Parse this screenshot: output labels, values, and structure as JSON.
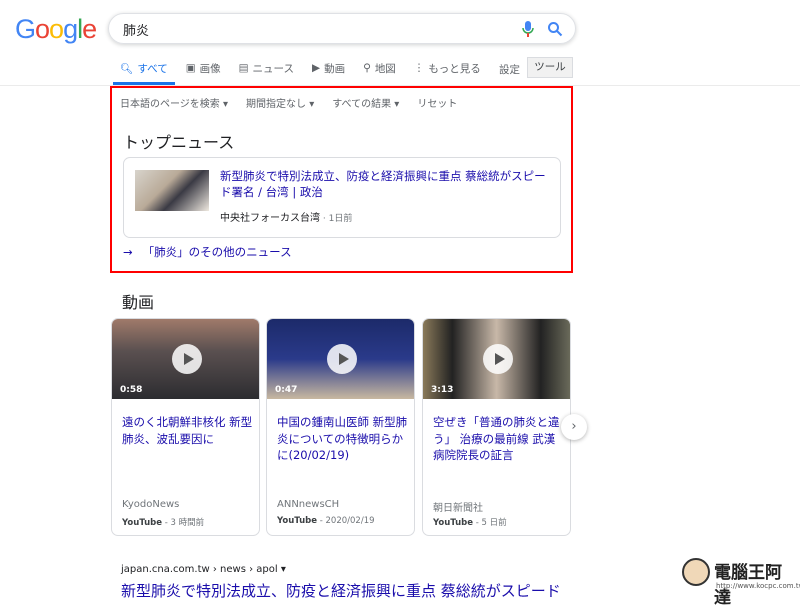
{
  "logo": "Google",
  "search": {
    "query": "肺炎"
  },
  "tabs": [
    {
      "label": "すべて",
      "icon": "search-icon"
    },
    {
      "label": "画像",
      "icon": "image-icon"
    },
    {
      "label": "ニュース",
      "icon": "news-icon"
    },
    {
      "label": "動画",
      "icon": "video-icon"
    },
    {
      "label": "地図",
      "icon": "map-pin-icon"
    },
    {
      "label": "もっと見る",
      "icon": "more-vert-icon"
    }
  ],
  "settings_label": "設定",
  "tools_label": "ツール",
  "filters": [
    "日本語のページを検索",
    "期間指定なし",
    "すべての結果",
    "リセット"
  ],
  "top_news": {
    "heading": "トップニュース",
    "title": "新型肺炎で特別法成立、防疫と経済振興に重点 蔡総統がスピード署名 / 台湾 | 政治",
    "source": "中央社フォーカス台湾",
    "time": "1日前",
    "more": "「肺炎」のその他のニュース"
  },
  "videos": {
    "heading": "動画",
    "items": [
      {
        "duration": "0:58",
        "title": "遠のく北朝鮮非核化 新型肺炎、波乱要因に",
        "channel": "KyodoNews",
        "platform": "YouTube",
        "date": "3 時間前"
      },
      {
        "duration": "0:47",
        "title": "中国の鍾南山医師 新型肺炎についての特徴明らかに(20/02/19)",
        "channel": "ANNnewsCH",
        "platform": "YouTube",
        "date": "2020/02/19"
      },
      {
        "duration": "3:13",
        "title": "空ぜき「普通の肺炎と違う」 治療の最前線 武漢病院院長の証言",
        "channel": "朝日新聞社",
        "platform": "YouTube",
        "date": "5 日前"
      }
    ]
  },
  "result": {
    "url": "japan.cna.com.tw › news › apol",
    "title": "新型肺炎で特別法成立、防疫と経済振興に重点 蔡総統がスピード"
  },
  "watermark": {
    "name": "電腦王阿達",
    "url": "http://www.kocpc.com.tw"
  }
}
